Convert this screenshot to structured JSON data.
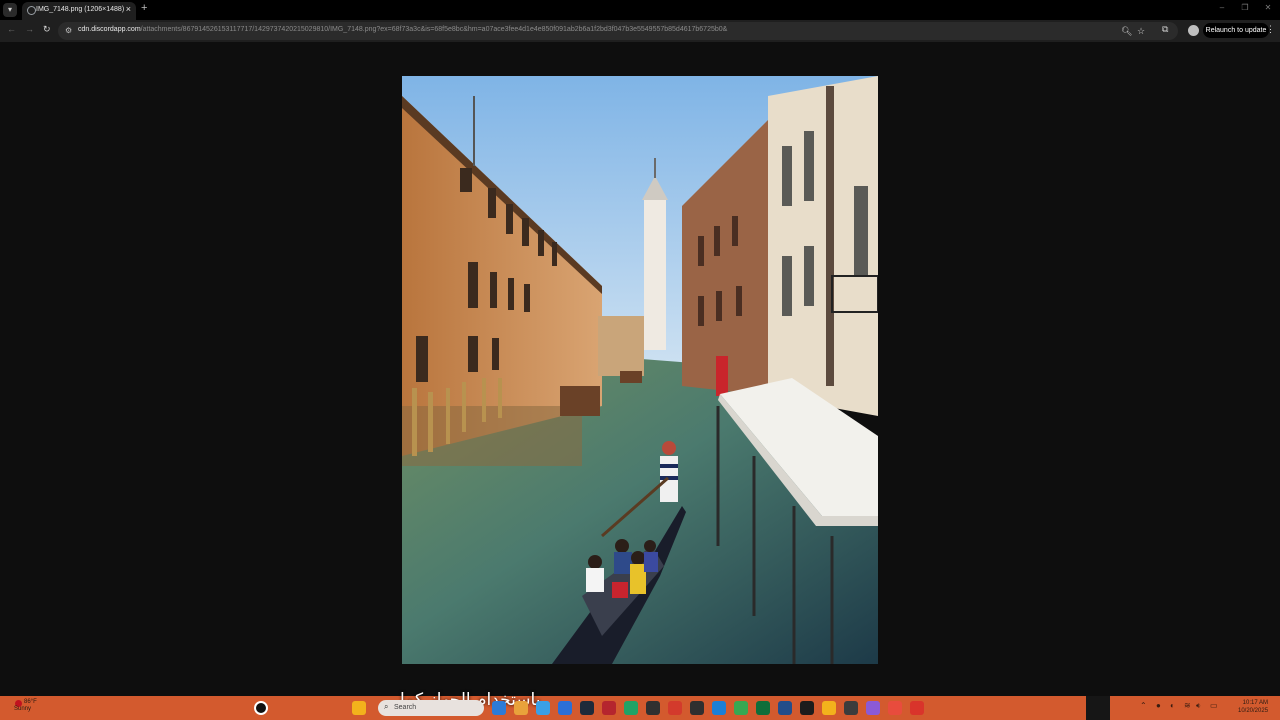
{
  "browser": {
    "tab_title": "IMG_7148.png (1206×1488)",
    "new_tab": "+",
    "url_host": "cdn.discordapp.com",
    "url_path": "/attachments/867914526153117717/1429737420215029810/IMG_7148.png?ex=68f73a3c&is=68f5e8bc&hm=a07ace3fee4d1e4e850f091ab2b6a1f2bd3f047b3e5549557b85d4617b6725b0&",
    "relaunch_label": "Relaunch to update"
  },
  "viewer": {
    "image_name": "IMG_7148.png"
  },
  "taskbar": {
    "weather_temp": "86°F",
    "weather_desc": "Sunny",
    "search_placeholder": "Search",
    "overlay_text": "باستخدام الجهاز كما",
    "clock_time": "10:17 AM",
    "clock_date": "10/20/2025",
    "app_colors": [
      "#2d7bd6",
      "#e9a23b",
      "#3aa0e6",
      "#2b6fd6",
      "#1f2a3a",
      "#b5252e",
      "#21a366",
      "#303030",
      "#d33a2c",
      "#2f2f2f",
      "#1b7fd6",
      "#36a852",
      "#0f6e3a",
      "#234d8a",
      "#1c1c1c",
      "#f3b21c",
      "#3c3c3c",
      "#8b5ad6",
      "#e84c3d",
      "#d9342b"
    ]
  }
}
